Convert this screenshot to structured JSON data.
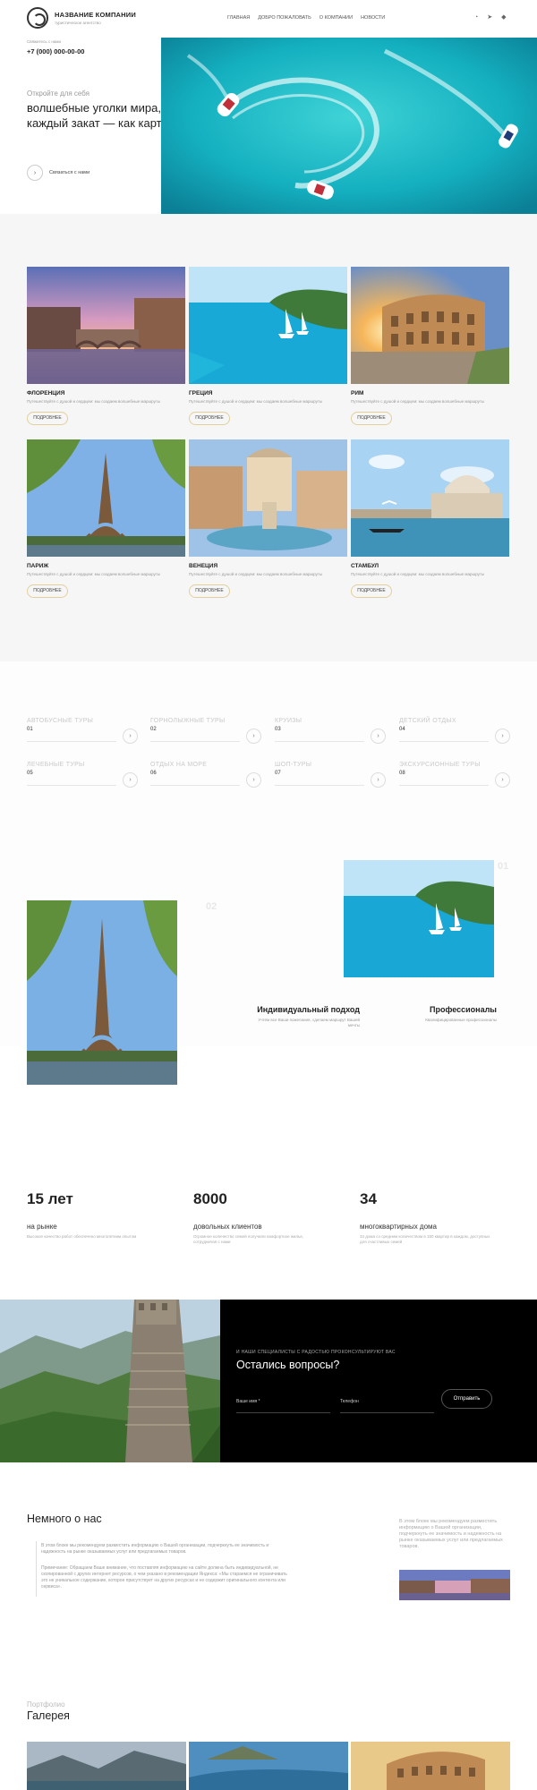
{
  "header": {
    "company_name": "НАЗВАНИЕ КОМПАНИИ",
    "company_sub": "туристическое агентство",
    "nav": [
      "ГЛАВНАЯ",
      "ДОБРО ПОЖАЛОВАТЬ",
      "О КОМПАНИИ",
      "НОВОСТИ"
    ],
    "social": [
      "whatsapp-icon",
      "telegram-icon",
      "vk-icon"
    ]
  },
  "hero": {
    "phone_label": "Свяжитесь с нами",
    "phone": "+7 (000) 000-00-00",
    "eyebrow": "Откройте для себя",
    "title": "волшебные уголки мира, где каждый закат — как картина",
    "contact_label": "Связаться с нами"
  },
  "destinations": [
    {
      "title": "ФЛОРЕНЦИЯ",
      "desc": "Путешествуйте с душой и сердцем: мы создаем волшебные маршруты",
      "more": "ПОДРОБНЕЕ"
    },
    {
      "title": "ГРЕЦИЯ",
      "desc": "Путешествуйте с душой и сердцем: мы создаем волшебные маршруты",
      "more": "ПОДРОБНЕЕ"
    },
    {
      "title": "РИМ",
      "desc": "Путешествуйте с душой и сердцем: мы создаем волшебные маршруты",
      "more": "ПОДРОБНЕЕ"
    },
    {
      "title": "ПАРИЖ",
      "desc": "Путешествуйте с душой и сердцем: мы создаем волшебные маршруты",
      "more": "ПОДРОБНЕЕ"
    },
    {
      "title": "ВЕНЕЦИЯ",
      "desc": "Путешествуйте с душой и сердцем: мы создаем волшебные маршруты",
      "more": "ПОДРОБНЕЕ"
    },
    {
      "title": "СТАМБУЛ",
      "desc": "Путешествуйте с душой и сердцем: мы создаем волшебные маршруты",
      "more": "ПОДРОБНЕЕ"
    }
  ],
  "tours": [
    {
      "name": "АВТОБУСНЫЕ ТУРЫ",
      "num": "01"
    },
    {
      "name": "ГОРНОЛЫЖНЫЕ ТУРЫ",
      "num": "02"
    },
    {
      "name": "КРУИЗЫ",
      "num": "03"
    },
    {
      "name": "ДЕТСКИЙ ОТДЫХ",
      "num": "04"
    },
    {
      "name": "ЛЕЧЕБНЫЕ ТУРЫ",
      "num": "05"
    },
    {
      "name": "ОТДЫХ НА МОРЕ",
      "num": "06"
    },
    {
      "name": "ШОП-ТУРЫ",
      "num": "07"
    },
    {
      "name": "ЭКСКУРСИОННЫЕ ТУРЫ",
      "num": "08"
    }
  ],
  "features": [
    {
      "num": "01",
      "title": "Профессионалы",
      "desc": "Квалифицированные профессионалы"
    },
    {
      "num": "02",
      "title": "Индивидуальный подход",
      "desc": "Учтем все Ваши пожелания, сделаем маршрут Вашей мечты"
    }
  ],
  "stats": [
    {
      "num": "15 лет",
      "label": "на рынке",
      "desc": "Высокое качество работ обеспечено многолетним опытом"
    },
    {
      "num": "8000",
      "label": "довольных клиентов",
      "desc": "Огромное количество семей получили комфортное жилье, сотрудничая с нами"
    },
    {
      "num": "34",
      "label": "многоквартирных дома",
      "desc": "34 дома со средним количеством в 150 квартир в каждом, доступных для счастливых семей"
    }
  ],
  "cta": {
    "eyebrow": "И НАШИ СПЕЦИАЛИСТЫ С РАДОСТЬЮ ПРОКОНСУЛЬТИРУЮТ ВАС",
    "title": "Остались вопросы?",
    "name_placeholder": "Ваше имя *",
    "phone_placeholder": "Телефон",
    "send": "Отправить"
  },
  "about": {
    "title": "Немного о нас",
    "p1": "В этом блоке мы рекомендуем разместить информацию о Вашей организации, подчеркнуть ее значимость и надежность на рынке оказываемых услуг или предлагаемых товаров.",
    "p2": "Примечание: Обращаем Ваше внимание, что поставляя информацию на сайте должна быть индивидуальной, не скопированной с других интернет ресурсов, о чем указано в рекомендации Яндекса: «Мы стараемся не ограничивать это не уникальное содержание, которое присутствует на других ресурсах и не содержит оригинального контента или сервиса».",
    "side": "В этом блоке мы рекомендуем разместить информацию о Вашей организации, подчеркнуть ее значимость и надежность на рынке оказываемых услуг или предлагаемых товаров."
  },
  "gallery": {
    "eyebrow": "Портфолио",
    "title": "Галерея"
  }
}
